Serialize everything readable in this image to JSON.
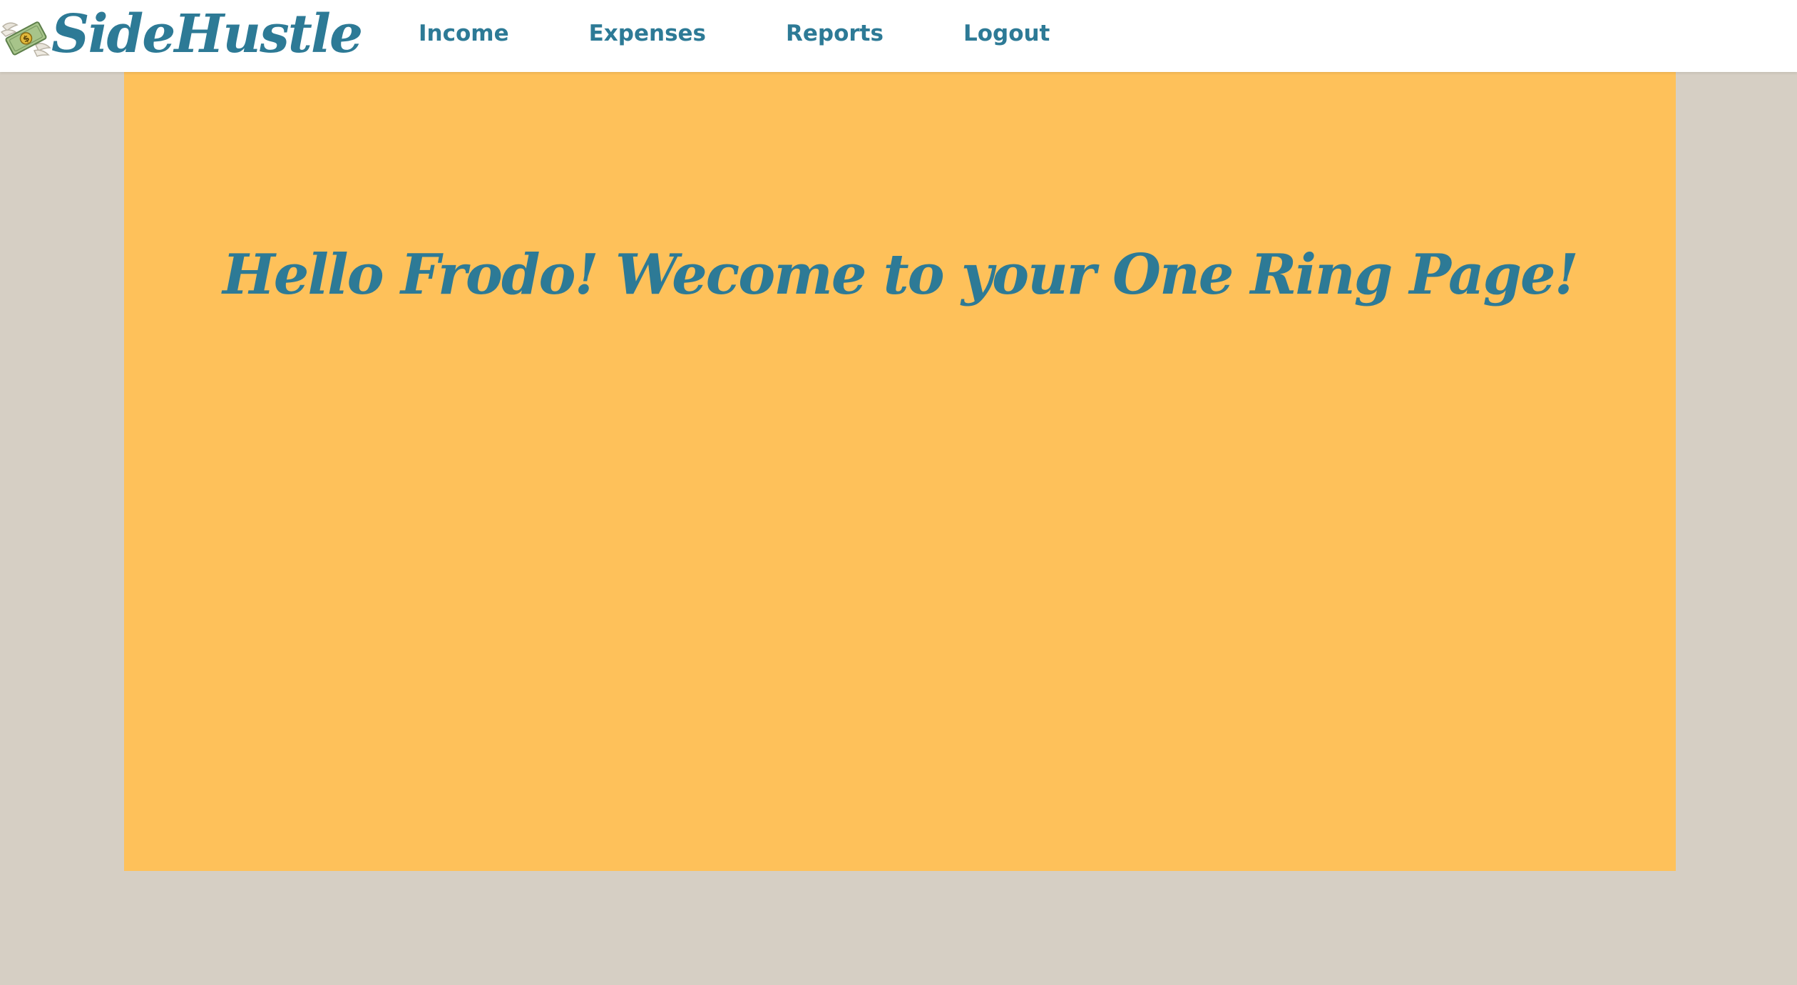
{
  "brand": {
    "name": "SideHustle",
    "icon": "money-with-wings-icon"
  },
  "nav": {
    "items": [
      {
        "label": "Income"
      },
      {
        "label": "Expenses"
      },
      {
        "label": "Reports"
      },
      {
        "label": "Logout"
      }
    ]
  },
  "main": {
    "heading": "Hello Frodo! Wecome to your One Ring Page!"
  },
  "colors": {
    "accent": "#2d7a96",
    "card_background": "#fec15a",
    "page_background": "#d6cfc4",
    "navbar_background": "#ffffff"
  }
}
